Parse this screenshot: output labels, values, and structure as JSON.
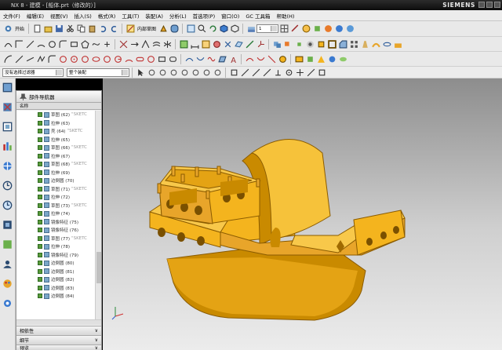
{
  "window": {
    "title": "NX 8 - 建模 - [船体.prt（修改的）]",
    "brand": "SIEMENS"
  },
  "menu": [
    "文件(F)",
    "编辑(E)",
    "视图(V)",
    "插入(S)",
    "格式(R)",
    "工具(T)",
    "装配(A)",
    "分析(L)",
    "首选项(P)",
    "窗口(O)",
    "GC 工具箱",
    "帮助(H)"
  ],
  "toolbar": {
    "start_label": "开始",
    "sketch_label": "内部草图",
    "layer_value": "1"
  },
  "selbar": {
    "filter_value": "没有选择过滤器",
    "scope_value": "整个装配"
  },
  "navigator": {
    "title": "部件导航器",
    "col_name": "名称",
    "rows": [
      {
        "name": "草图 (62) ",
        "extra": "\"SKETC"
      },
      {
        "name": "拉伸 (63)",
        "extra": ""
      },
      {
        "name": "壳 (64) ",
        "extra": "\"SKETC"
      },
      {
        "name": "拉伸 (65)",
        "extra": ""
      },
      {
        "name": "草图 (66) ",
        "extra": "\"SKETC"
      },
      {
        "name": "拉伸 (67)",
        "extra": ""
      },
      {
        "name": "草图 (68) ",
        "extra": "\"SKETC"
      },
      {
        "name": "拉伸 (69)",
        "extra": ""
      },
      {
        "name": "边倒圆 (70)",
        "extra": ""
      },
      {
        "name": "草图 (71) ",
        "extra": "\"SKETC"
      },
      {
        "name": "拉伸 (72)",
        "extra": ""
      },
      {
        "name": "草图 (73) ",
        "extra": "\"SKETC"
      },
      {
        "name": "拉伸 (74)",
        "extra": ""
      },
      {
        "name": "镜像特征 (75)",
        "extra": ""
      },
      {
        "name": "镜像特征 (76)",
        "extra": ""
      },
      {
        "name": "草图 (77) ",
        "extra": "\"SKETC"
      },
      {
        "name": "拉伸 (78)",
        "extra": ""
      },
      {
        "name": "镜像特征 (79)",
        "extra": ""
      },
      {
        "name": "边倒圆 (80)",
        "extra": ""
      },
      {
        "name": "边倒圆 (81)",
        "extra": ""
      },
      {
        "name": "边倒圆 (82)",
        "extra": ""
      },
      {
        "name": "边倒圆 (83)",
        "extra": ""
      },
      {
        "name": "边倒圆 (84)",
        "extra": ""
      }
    ],
    "sections": [
      "相依性",
      "细节",
      "预览"
    ]
  },
  "colors": {
    "model_body": "#f4b41e",
    "model_shadow": "#c98a00",
    "model_dark": "#8a5b00"
  }
}
